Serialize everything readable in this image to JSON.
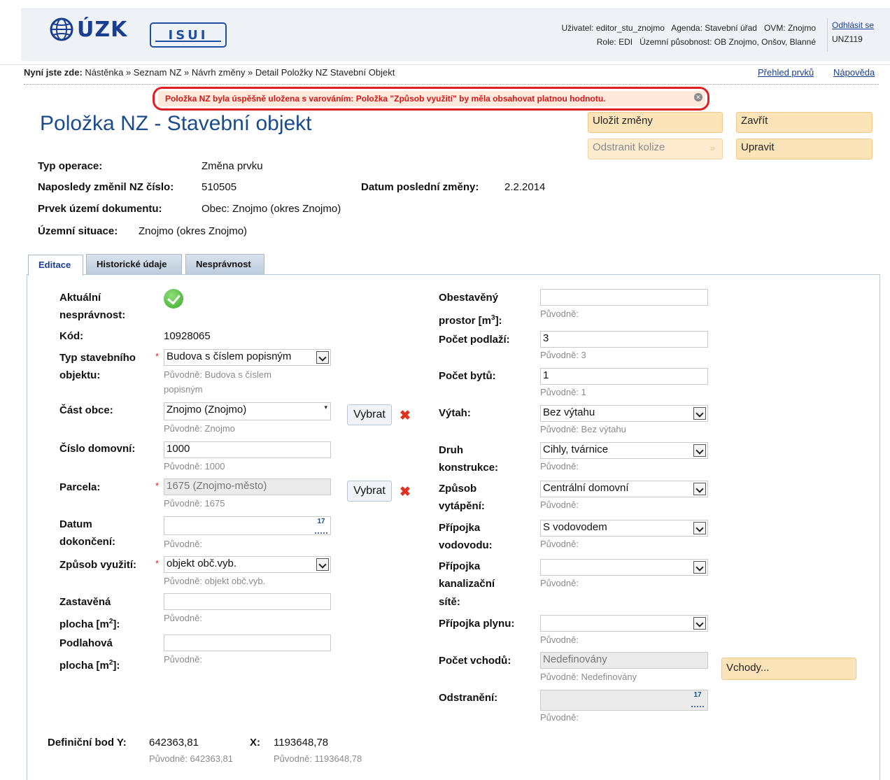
{
  "header": {
    "logo_cuzk": "ÚZK",
    "logo_isui": "ISUI",
    "user_line1": "Uživatel: editor_stu_znojmo   Agenda: Stavební úřad   OVM: Znojmo",
    "user_line2": "Role: EDI   Územní působnost: OB Znojmo, Onšov, Blanné",
    "logout": "Odhlásit se",
    "code": "UNZ119"
  },
  "breadcrumb": {
    "label": "Nyní jste zde:",
    "path": " Nástěnka » Seznam NZ » Návrh změny » Detail Položky NZ Stavební Objekt",
    "overview": "Přehled prvků",
    "help": "Nápověda"
  },
  "warning": "Položka NZ byla úspěšně uložena s varováním: Položka \"Způsob využití\" by měla obsahovat platnou hodnotu.",
  "title": "Položka NZ - Stavební objekt",
  "buttons": {
    "save": "Uložit změny",
    "close": "Zavřít",
    "remove_collision": "Odstranit kolize",
    "edit": "Upravit",
    "entrances": "Vchody..."
  },
  "info": {
    "op_type_label": "Typ operace:",
    "op_type": "Změna prvku",
    "last_changed_label": "Naposledy změnil NZ číslo:",
    "last_changed": "510505",
    "date_label": "Datum poslední změny:",
    "date": "2.2.2014",
    "element_label": "Prvek území dokumentu:",
    "element": "Obec: Znojmo (okres Znojmo)",
    "situation_label": "Územní situace:",
    "situation": "Znojmo (okres Znojmo)"
  },
  "tabs": [
    "Editace",
    "Historické údaje",
    "Nesprávnost"
  ],
  "form_left": {
    "current_incorrectness_l1": "Aktuální",
    "current_incorrectness_l2": "nesprávnost:",
    "code_label": "Kód:",
    "code": "10928065",
    "building_type_l1": "Typ stavebního",
    "building_type_l2": "objektu:",
    "building_type": "Budova s číslem popisným",
    "building_type_orig_l1": "Původně: Budova s číslem",
    "building_type_orig_l2": "popisným",
    "district_label": "Část obce:",
    "district": "Znojmo (Znojmo)",
    "district_orig": "Původně: Znojmo",
    "select": "Vybrat",
    "house_no_label": "Číslo domovní:",
    "house_no": "1000",
    "house_no_orig": "Původně: 1000",
    "parcel_label": "Parcela:",
    "parcel": "1675 (Znojmo-město)",
    "parcel_orig": "Původně: 1675",
    "completion_l1": "Datum",
    "completion_l2": "dokončení:",
    "completion_orig": "Původně:",
    "usage_label": "Způsob využití:",
    "usage": "objekt obč.vyb.",
    "usage_orig": "Původně: objekt obč.vyb.",
    "built_area_l1": "Zastavěná",
    "built_area_l2": "plocha [m",
    "floor_area_l1": "Podlahová",
    "floor_area_l2": "plocha [m",
    "sup2": "2",
    "suffix": "]:",
    "orig_empty": "Původně:"
  },
  "form_right": {
    "volume_l1": "Obestavěný",
    "volume_l2": "prostor [m",
    "sup3": "3",
    "suffix": "]:",
    "floors_label": "Počet podlaží:",
    "floors": "3",
    "floors_orig": "Původně: 3",
    "flats_label": "Počet bytů:",
    "flats": "1",
    "flats_orig": "Původně: 1",
    "lift_label": "Výtah:",
    "lift": "Bez výtahu",
    "lift_orig": "Původně: Bez výtahu",
    "construction_l1": "Druh",
    "construction_l2": "konstrukce:",
    "construction": "Cihly, tvárnice",
    "heating_l1": "Způsob",
    "heating_l2": "vytápění:",
    "heating": "Centrální domovní",
    "water_l1": "Přípojka",
    "water_l2": "vodovodu:",
    "water": "S vodovodem",
    "sewer_l1": "Přípojka",
    "sewer_l2": "kanalizační",
    "sewer_l3": "sítě:",
    "gas_label": "Přípojka plynu:",
    "entrances_label": "Počet vchodů:",
    "entrances": "Nedefinovány",
    "entrances_orig": "Původně: Nedefinovány",
    "removal_label": "Odstranění:",
    "orig_empty": "Původně:"
  },
  "defpoint": {
    "label_y": "Definiční bod Y:",
    "y": "642363,81",
    "y_orig": "Původně: 642363,81",
    "label_x": "X:",
    "x": "1193648,78",
    "x_orig": "Původně: 1193648,78"
  },
  "calendar_glyph": "17",
  "close_glyph": "✕",
  "delete_glyph": "✖",
  "next_glyph": "»",
  "combo_glyph": "▾",
  "colors": {
    "title": "#1a4b8a",
    "button_bg": "#fde3b8",
    "warning_border": "#e02020",
    "warning_text": "#d41616",
    "required": "#e02020"
  }
}
